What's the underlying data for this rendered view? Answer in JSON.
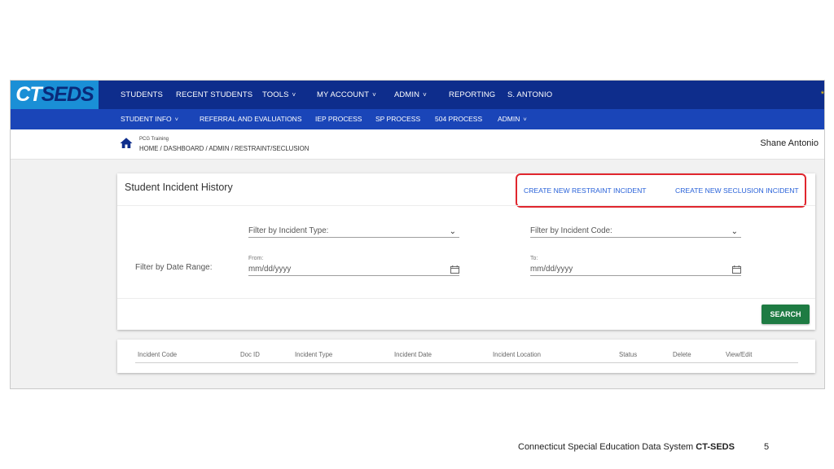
{
  "logo": {
    "part1": "CT",
    "part2": "SEDS"
  },
  "top_nav": [
    {
      "label": "STUDENTS",
      "caret": false
    },
    {
      "label": "RECENT STUDENTS",
      "caret": false
    },
    {
      "label": "TOOLS",
      "caret": true
    },
    {
      "label": "MY ACCOUNT",
      "caret": true
    },
    {
      "label": "ADMIN",
      "caret": true
    },
    {
      "label": "REPORTING",
      "caret": false
    },
    {
      "label": "S. ANTONIO",
      "caret": false
    }
  ],
  "top_nav_extra": "*",
  "sub_nav": [
    {
      "label": "STUDENT INFO",
      "caret": true
    },
    {
      "label": "REFERRAL AND EVALUATIONS",
      "caret": false
    },
    {
      "label": "IEP PROCESS",
      "caret": false
    },
    {
      "label": "SP PROCESS",
      "caret": false
    },
    {
      "label": "504 PROCESS",
      "caret": false
    },
    {
      "label": "ADMIN",
      "caret": true
    }
  ],
  "breadcrumb": {
    "org": "PCG Training",
    "path": "HOME / DASHBOARD  /  ADMIN  /  RESTRAINT/SECLUSION"
  },
  "user_name": "Shane Antonio",
  "panel": {
    "title": "Student Incident History",
    "create_restraint": "CREATE NEW RESTRAINT INCIDENT",
    "create_seclusion": "CREATE NEW SECLUSION INCIDENT",
    "filter_type": "Filter by Incident Type:",
    "filter_code": "Filter by Incident Code:",
    "date_range_label": "Filter by Date Range:",
    "from_label": "From:",
    "from_placeholder": "mm/dd/yyyy",
    "to_label": "To:",
    "to_placeholder": "mm/dd/yyyy",
    "search_label": "SEARCH"
  },
  "table": {
    "columns": [
      "Incident Code",
      "Doc ID",
      "Incident Type",
      "Incident Date",
      "Incident Location",
      "Status",
      "Delete",
      "View/Edit"
    ]
  },
  "footer": {
    "text": "Connecticut Special Education Data System ",
    "bold": "CT-SEDS",
    "page": "5"
  },
  "colors": {
    "nav_primary": "#0e2d8c",
    "nav_secondary": "#1a45b8",
    "logo_bg": "#1a8fd6",
    "link": "#2962d9",
    "highlight": "#e0262e",
    "search_button": "#1e7b43"
  },
  "icons": [
    "home-icon",
    "chevron-down-icon",
    "calendar-icon"
  ]
}
